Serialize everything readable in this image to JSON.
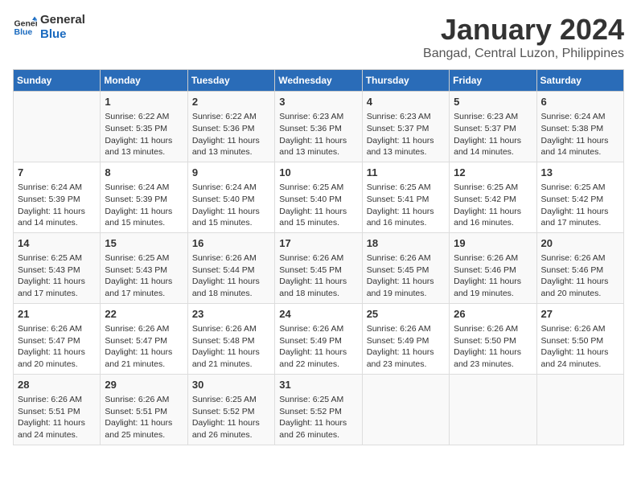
{
  "header": {
    "logo_line1": "General",
    "logo_line2": "Blue",
    "title": "January 2024",
    "subtitle": "Bangad, Central Luzon, Philippines"
  },
  "days_of_week": [
    "Sunday",
    "Monday",
    "Tuesday",
    "Wednesday",
    "Thursday",
    "Friday",
    "Saturday"
  ],
  "weeks": [
    [
      {
        "day": "",
        "content": ""
      },
      {
        "day": "1",
        "content": "Sunrise: 6:22 AM\nSunset: 5:35 PM\nDaylight: 11 hours\nand 13 minutes."
      },
      {
        "day": "2",
        "content": "Sunrise: 6:22 AM\nSunset: 5:36 PM\nDaylight: 11 hours\nand 13 minutes."
      },
      {
        "day": "3",
        "content": "Sunrise: 6:23 AM\nSunset: 5:36 PM\nDaylight: 11 hours\nand 13 minutes."
      },
      {
        "day": "4",
        "content": "Sunrise: 6:23 AM\nSunset: 5:37 PM\nDaylight: 11 hours\nand 13 minutes."
      },
      {
        "day": "5",
        "content": "Sunrise: 6:23 AM\nSunset: 5:37 PM\nDaylight: 11 hours\nand 14 minutes."
      },
      {
        "day": "6",
        "content": "Sunrise: 6:24 AM\nSunset: 5:38 PM\nDaylight: 11 hours\nand 14 minutes."
      }
    ],
    [
      {
        "day": "7",
        "content": "Sunrise: 6:24 AM\nSunset: 5:39 PM\nDaylight: 11 hours\nand 14 minutes."
      },
      {
        "day": "8",
        "content": "Sunrise: 6:24 AM\nSunset: 5:39 PM\nDaylight: 11 hours\nand 15 minutes."
      },
      {
        "day": "9",
        "content": "Sunrise: 6:24 AM\nSunset: 5:40 PM\nDaylight: 11 hours\nand 15 minutes."
      },
      {
        "day": "10",
        "content": "Sunrise: 6:25 AM\nSunset: 5:40 PM\nDaylight: 11 hours\nand 15 minutes."
      },
      {
        "day": "11",
        "content": "Sunrise: 6:25 AM\nSunset: 5:41 PM\nDaylight: 11 hours\nand 16 minutes."
      },
      {
        "day": "12",
        "content": "Sunrise: 6:25 AM\nSunset: 5:42 PM\nDaylight: 11 hours\nand 16 minutes."
      },
      {
        "day": "13",
        "content": "Sunrise: 6:25 AM\nSunset: 5:42 PM\nDaylight: 11 hours\nand 17 minutes."
      }
    ],
    [
      {
        "day": "14",
        "content": "Sunrise: 6:25 AM\nSunset: 5:43 PM\nDaylight: 11 hours\nand 17 minutes."
      },
      {
        "day": "15",
        "content": "Sunrise: 6:25 AM\nSunset: 5:43 PM\nDaylight: 11 hours\nand 17 minutes."
      },
      {
        "day": "16",
        "content": "Sunrise: 6:26 AM\nSunset: 5:44 PM\nDaylight: 11 hours\nand 18 minutes."
      },
      {
        "day": "17",
        "content": "Sunrise: 6:26 AM\nSunset: 5:45 PM\nDaylight: 11 hours\nand 18 minutes."
      },
      {
        "day": "18",
        "content": "Sunrise: 6:26 AM\nSunset: 5:45 PM\nDaylight: 11 hours\nand 19 minutes."
      },
      {
        "day": "19",
        "content": "Sunrise: 6:26 AM\nSunset: 5:46 PM\nDaylight: 11 hours\nand 19 minutes."
      },
      {
        "day": "20",
        "content": "Sunrise: 6:26 AM\nSunset: 5:46 PM\nDaylight: 11 hours\nand 20 minutes."
      }
    ],
    [
      {
        "day": "21",
        "content": "Sunrise: 6:26 AM\nSunset: 5:47 PM\nDaylight: 11 hours\nand 20 minutes."
      },
      {
        "day": "22",
        "content": "Sunrise: 6:26 AM\nSunset: 5:47 PM\nDaylight: 11 hours\nand 21 minutes."
      },
      {
        "day": "23",
        "content": "Sunrise: 6:26 AM\nSunset: 5:48 PM\nDaylight: 11 hours\nand 21 minutes."
      },
      {
        "day": "24",
        "content": "Sunrise: 6:26 AM\nSunset: 5:49 PM\nDaylight: 11 hours\nand 22 minutes."
      },
      {
        "day": "25",
        "content": "Sunrise: 6:26 AM\nSunset: 5:49 PM\nDaylight: 11 hours\nand 23 minutes."
      },
      {
        "day": "26",
        "content": "Sunrise: 6:26 AM\nSunset: 5:50 PM\nDaylight: 11 hours\nand 23 minutes."
      },
      {
        "day": "27",
        "content": "Sunrise: 6:26 AM\nSunset: 5:50 PM\nDaylight: 11 hours\nand 24 minutes."
      }
    ],
    [
      {
        "day": "28",
        "content": "Sunrise: 6:26 AM\nSunset: 5:51 PM\nDaylight: 11 hours\nand 24 minutes."
      },
      {
        "day": "29",
        "content": "Sunrise: 6:26 AM\nSunset: 5:51 PM\nDaylight: 11 hours\nand 25 minutes."
      },
      {
        "day": "30",
        "content": "Sunrise: 6:25 AM\nSunset: 5:52 PM\nDaylight: 11 hours\nand 26 minutes."
      },
      {
        "day": "31",
        "content": "Sunrise: 6:25 AM\nSunset: 5:52 PM\nDaylight: 11 hours\nand 26 minutes."
      },
      {
        "day": "",
        "content": ""
      },
      {
        "day": "",
        "content": ""
      },
      {
        "day": "",
        "content": ""
      }
    ]
  ]
}
